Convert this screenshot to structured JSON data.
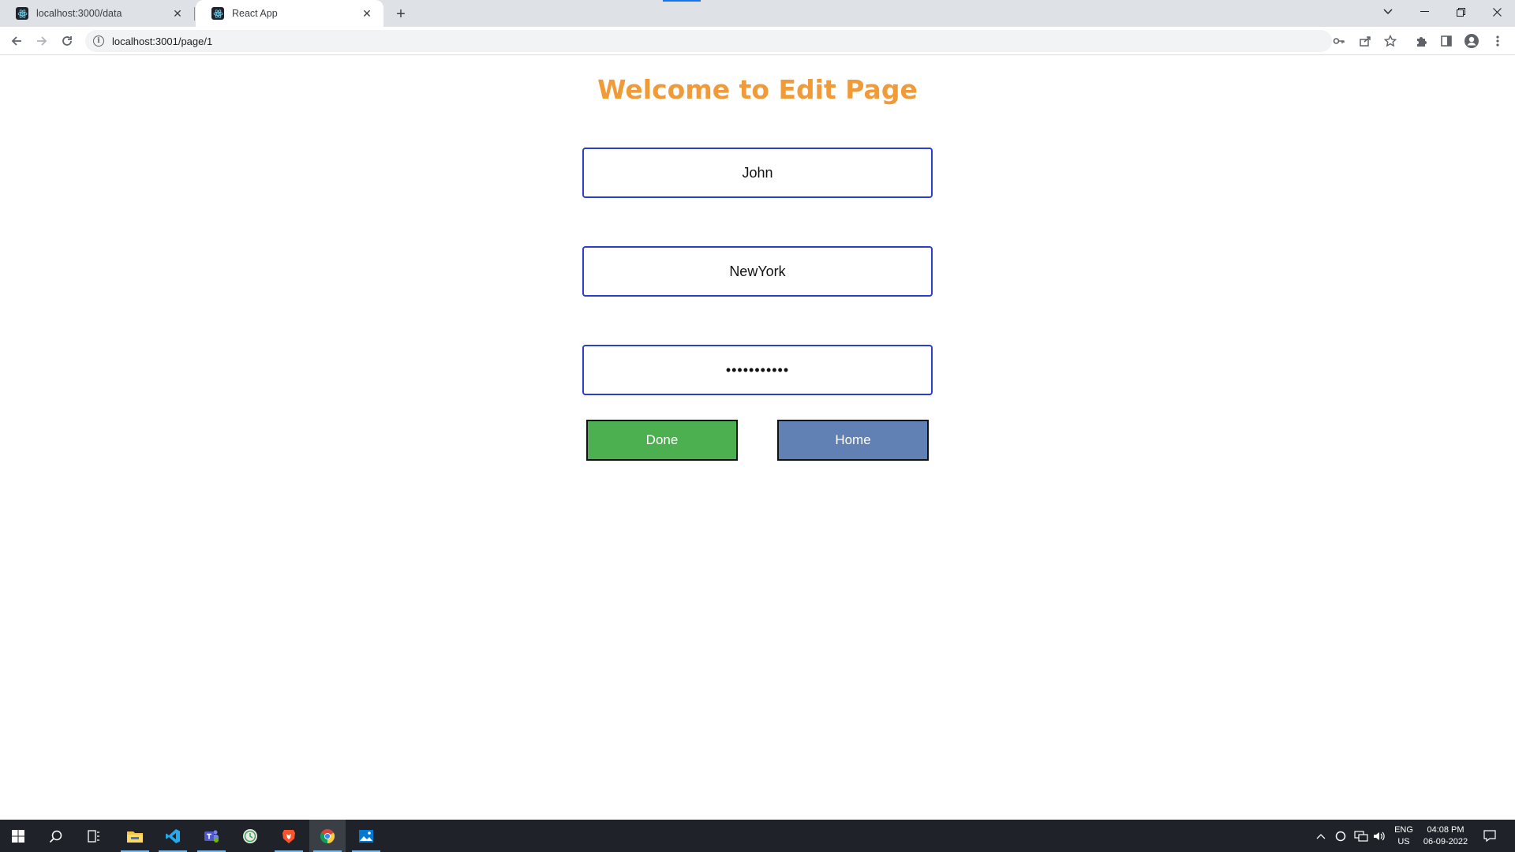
{
  "browser": {
    "tabs": [
      {
        "title": "localhost:3000/data",
        "active": false
      },
      {
        "title": "React App",
        "active": true
      }
    ],
    "url": "localhost:3001/page/1"
  },
  "page": {
    "heading": "Welcome to Edit Page",
    "fields": {
      "name_value": "John",
      "city_value": "NewYork",
      "password_value": "•••••••••••"
    },
    "buttons": {
      "done_label": "Done",
      "home_label": "Home"
    }
  },
  "taskbar": {
    "language": "ENG",
    "region": "US",
    "time": "04:08 PM",
    "date": "06-09-2022"
  },
  "colors": {
    "heading": "#f19a38",
    "field_border": "#2b3fcf",
    "done_button": "#4caf50",
    "home_button": "#6180b3",
    "taskbar": "#1f2329"
  }
}
